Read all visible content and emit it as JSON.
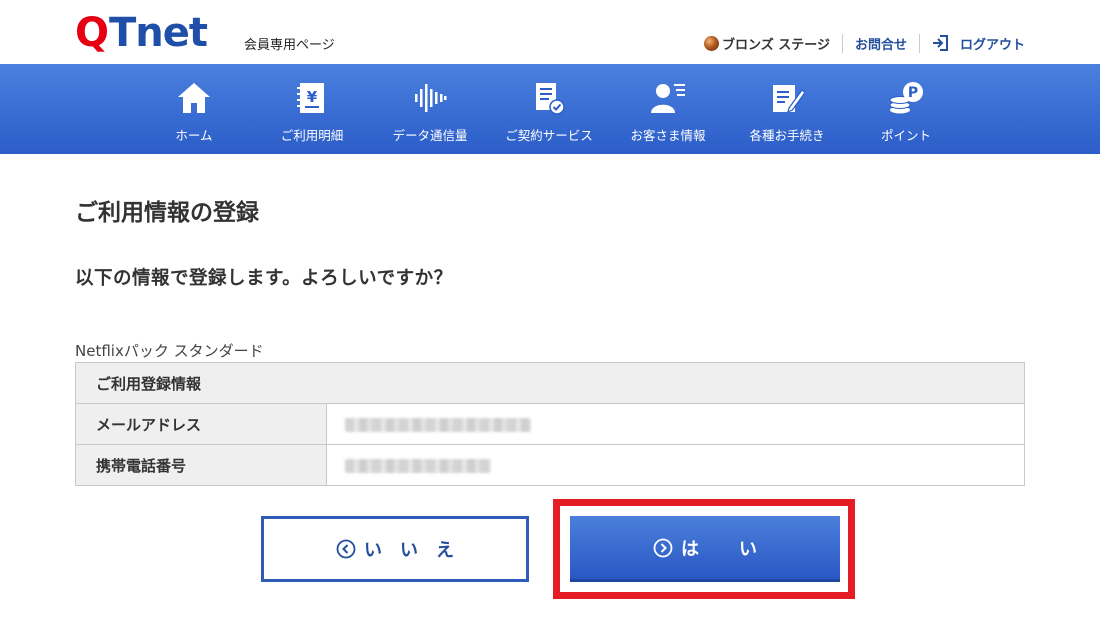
{
  "header": {
    "logo_text": "QTnet",
    "logo_sub": "会員専用ページ",
    "stage": "ブロンズ ステージ",
    "contact": "お問合せ",
    "logout": "ログアウト"
  },
  "nav": [
    {
      "label": "ホーム",
      "icon": "home-icon"
    },
    {
      "label": "ご利用明細",
      "icon": "invoice-yen-icon"
    },
    {
      "label": "データ通信量",
      "icon": "data-waveform-icon"
    },
    {
      "label": "ご契約サービス",
      "icon": "contract-check-icon"
    },
    {
      "label": "お客さま情報",
      "icon": "customer-profile-icon"
    },
    {
      "label": "各種お手続き",
      "icon": "form-edit-icon"
    },
    {
      "label": "ポイント",
      "icon": "points-coin-icon"
    }
  ],
  "main": {
    "title": "ご利用情報の登録",
    "question": "以下の情報で登録します。よろしいですか？",
    "plan_name": "Netflixパック スタンダード",
    "table": {
      "section_header": "ご利用登録情報",
      "rows": [
        {
          "label": "メールアドレス",
          "value_masked": true
        },
        {
          "label": "携帯電話番号",
          "value_masked": true
        }
      ]
    }
  },
  "buttons": {
    "no": "いいえ",
    "yes": "はい"
  },
  "colors": {
    "brand_red": "#e60012",
    "brand_blue": "#2c5dc9",
    "link_blue": "#234f9c",
    "highlight_red": "#e51c23"
  }
}
